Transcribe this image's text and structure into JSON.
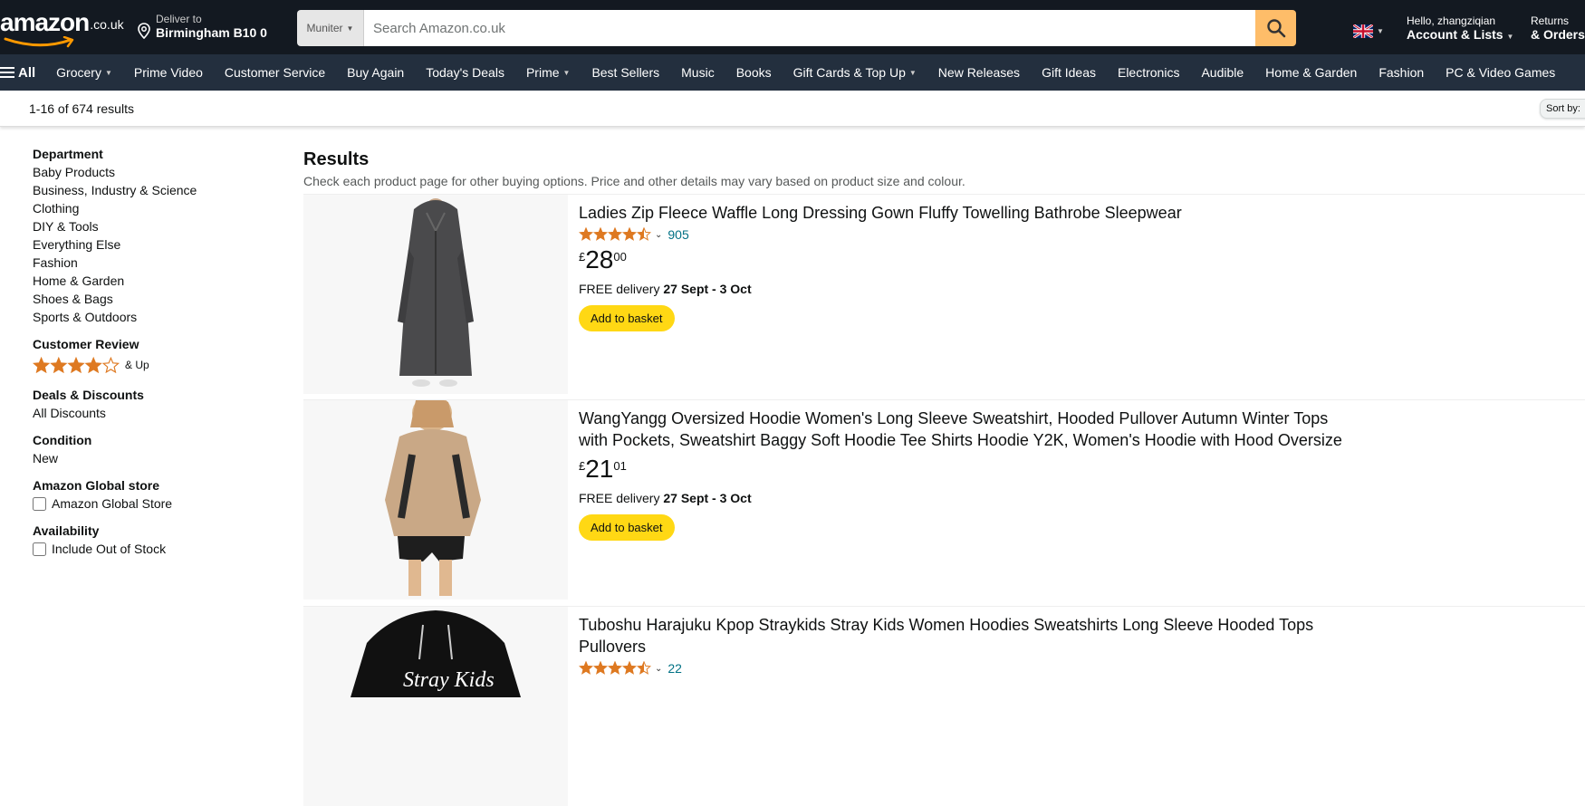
{
  "header": {
    "logo_text": "amazon",
    "logo_tld": ".co.uk",
    "deliver_line1": "Deliver to",
    "deliver_line2": "Birmingham B10 0",
    "search_dept": "Muniter",
    "search_placeholder": "Search Amazon.co.uk",
    "account_line1": "Hello, zhangziqian",
    "account_line2": "Account & Lists",
    "returns_line1": "Returns",
    "returns_line2": "& Orders"
  },
  "nav": {
    "all_label": "All",
    "items": [
      "Grocery",
      "Prime Video",
      "Customer Service",
      "Buy Again",
      "Today's Deals",
      "Prime",
      "Best Sellers",
      "Music",
      "Books",
      "Gift Cards & Top Up",
      "New Releases",
      "Gift Ideas",
      "Electronics",
      "Audible",
      "Home & Garden",
      "Fashion",
      "PC & Video Games"
    ]
  },
  "results_bar": {
    "count": "1-16 of 674 results",
    "sort_label": "Sort by:"
  },
  "sidebar": {
    "department": {
      "heading": "Department",
      "items": [
        "Baby Products",
        "Business, Industry & Science",
        "Clothing",
        "DIY & Tools",
        "Everything Else",
        "Fashion",
        "Home & Garden",
        "Shoes & Bags",
        "Sports & Outdoors"
      ]
    },
    "review": {
      "heading": "Customer Review",
      "stars": 4,
      "suffix": "& Up"
    },
    "deals": {
      "heading": "Deals & Discounts",
      "item": "All Discounts"
    },
    "condition": {
      "heading": "Condition",
      "item": "New"
    },
    "global": {
      "heading": "Amazon Global store",
      "item": "Amazon Global Store"
    },
    "availability": {
      "heading": "Availability",
      "item": "Include Out of Stock"
    }
  },
  "main": {
    "title": "Results",
    "subtitle": "Check each product page for other buying options. Price and other details may vary based on product size and colour."
  },
  "products": [
    {
      "title": "Ladies Zip Fleece Waffle Long Dressing Gown Fluffy Towelling Bathrobe Sleepwear",
      "rating": 4.5,
      "reviews": "905",
      "price_symbol": "£",
      "price_whole": "28",
      "price_fraction": "00",
      "delivery_prefix": "FREE delivery",
      "delivery_dates": "27 Sept - 3 Oct",
      "button": "Add to basket"
    },
    {
      "title": "WangYangg Oversized Hoodie Women's Long Sleeve Sweatshirt, Hooded Pullover Autumn Winter Tops with Pockets, Sweatshirt Baggy Soft Hoodie Tee Shirts Hoodie Y2K, Women's Hoodie with Hood Oversize",
      "price_symbol": "£",
      "price_whole": "21",
      "price_fraction": "01",
      "delivery_prefix": "FREE delivery",
      "delivery_dates": "27 Sept - 3 Oct",
      "button": "Add to basket"
    },
    {
      "title": "Tuboshu Harajuku Kpop Straykids Stray Kids Women Hoodies Sweatshirts Long Sleeve Hooded Tops Pullovers",
      "rating": 4.5,
      "reviews": "22",
      "image_print": "Stray Kids"
    }
  ],
  "colors": {
    "header_bg": "#131921",
    "nav_bg": "#232f3e",
    "search_btn": "#febd69",
    "star": "#de7921",
    "link": "#007185",
    "add_button": "#ffd814"
  }
}
